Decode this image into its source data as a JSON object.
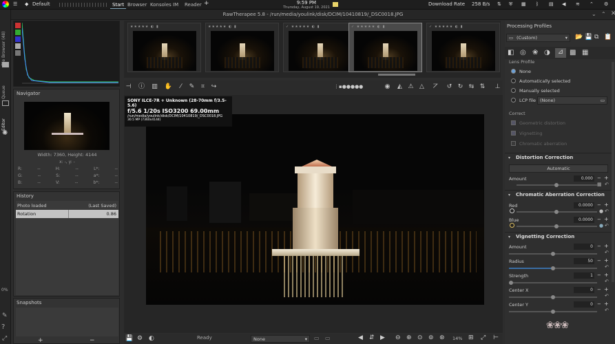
{
  "os": {
    "workspace": "Default",
    "tabs": [
      "Start",
      "Browser",
      "Konsoles",
      "IM",
      "Reader"
    ],
    "active_tab": "Start",
    "time": "9:59 PM",
    "date": "Thursday, August 19, 2021",
    "download_label": "Download Rate",
    "download_value": "258 B/s"
  },
  "window": {
    "title": "RawTherapee 5.8 - /run/media/youlink/disk/DCIM/10410819/_DSC0018.JPG"
  },
  "vtabs": [
    "File Browser (48)",
    "Queue",
    "Editor"
  ],
  "left_percent": "0%",
  "navigator": {
    "title": "Navigator",
    "size": "Width: 7360, Height: 4144",
    "coords": "x: -, y: -",
    "readouts": [
      [
        "R:",
        "--",
        "H:",
        "--",
        "L*:",
        "--"
      ],
      [
        "G:",
        "--",
        "S:",
        "--",
        "a*:",
        "--"
      ],
      [
        "B:",
        "--",
        "V:",
        "--",
        "b*:",
        "--"
      ]
    ]
  },
  "history": {
    "title": "History",
    "rows": [
      {
        "name": "Photo loaded",
        "value": "(Last Saved)"
      },
      {
        "name": "Rotation",
        "value": "0.86"
      }
    ]
  },
  "snapshots": {
    "title": "Snapshots",
    "add": "+",
    "remove": "−"
  },
  "image_info": {
    "camera": "SONY ILCE-7R + Unknown (28-70mm f/3.5-5.6)",
    "exposure": "f/5.6  1/20s  ISO3200  69.00mm",
    "path": "/run/media/youlink/disk/DCIM/10410819/_DSC0018.JPG",
    "size": "30.5 MP (7360x4144)"
  },
  "status": {
    "text": "Ready",
    "select": "None",
    "zoom": "14%"
  },
  "right": {
    "profiles_title": "Processing Profiles",
    "profile_value": "(Custom)",
    "lens_profile": {
      "title": "Lens Profile",
      "options": [
        "None",
        "Automatically selected",
        "Manually selected",
        "LCP file"
      ],
      "selected": "None",
      "lcp_value": "(None)",
      "correct_label": "Correct",
      "correct_items": [
        "Geometric distortion",
        "Vignetting",
        "Chromatic aberration"
      ]
    },
    "distortion": {
      "title": "Distortion Correction",
      "auto_label": "Automatic",
      "amount_label": "Amount",
      "amount": "0.000",
      "amount_fraction": 0.5
    },
    "ca": {
      "title": "Chromatic Aberration Correction",
      "red_label": "Red",
      "red": "0.0000",
      "blue_label": "Blue",
      "blue": "0.0000"
    },
    "vignetting": {
      "title": "Vignetting Correction",
      "rows": [
        {
          "label": "Amount",
          "value": "0",
          "fraction": 0.5
        },
        {
          "label": "Radius",
          "value": "50",
          "fraction": 0.5
        },
        {
          "label": "Strength",
          "value": "1",
          "fraction": 0.01
        },
        {
          "label": "Center X",
          "value": "0",
          "fraction": 0.5
        },
        {
          "label": "Center Y",
          "value": "0",
          "fraction": 0.5
        }
      ]
    }
  },
  "colors": {
    "accent": "#3a6ea5",
    "bg": "#2d2d2d",
    "panel": "#333333"
  }
}
